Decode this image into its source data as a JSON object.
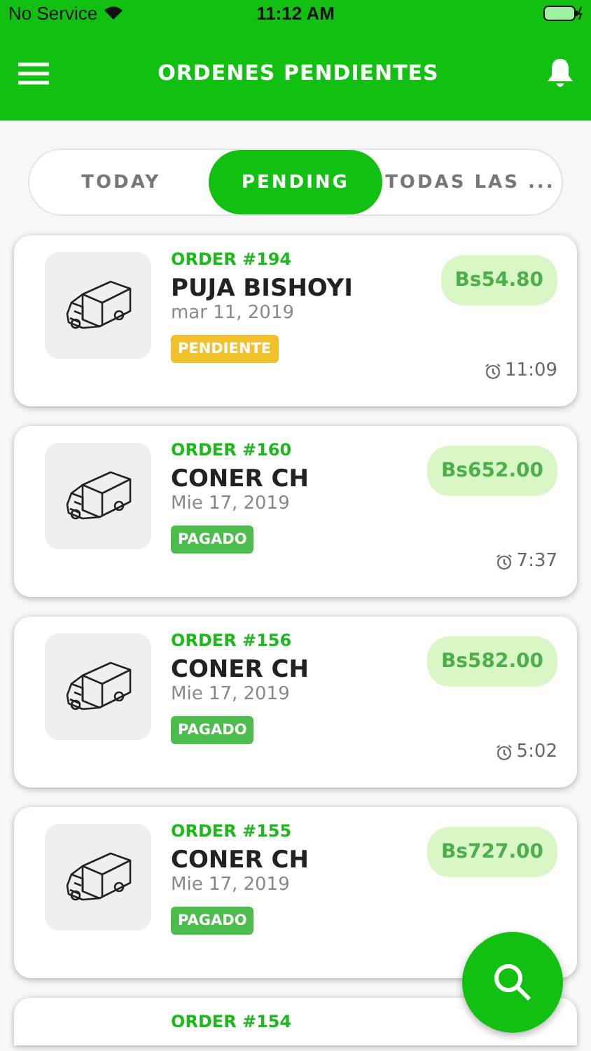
{
  "status_bar": {
    "carrier": "No Service",
    "time": "11:12 AM"
  },
  "header": {
    "title": "ORDENES PENDIENTES"
  },
  "tabs": [
    {
      "label": "TODAY",
      "selected": false
    },
    {
      "label": "PENDING",
      "selected": true
    },
    {
      "label": "TODAS LAS ...",
      "selected": false
    }
  ],
  "orders": [
    {
      "order": "ORDER #194",
      "name": "PUJA BISHOYI",
      "date": "mar 11, 2019",
      "status": "PENDIENTE",
      "kind": "pending",
      "price": "Bs54.80",
      "time": "11:09"
    },
    {
      "order": "ORDER #160",
      "name": "CONER CH",
      "date": "Mie 17, 2019",
      "status": "PAGADO",
      "kind": "paid",
      "price": "Bs652.00",
      "time": "7:37"
    },
    {
      "order": "ORDER #156",
      "name": "CONER CH",
      "date": "Mie 17, 2019",
      "status": "PAGADO",
      "kind": "paid",
      "price": "Bs582.00",
      "time": "5:02"
    },
    {
      "order": "ORDER #155",
      "name": "CONER CH",
      "date": "Mie 17, 2019",
      "status": "PAGADO",
      "kind": "paid",
      "price": "Bs727.00"
    },
    {
      "order": "ORDER #154"
    }
  ]
}
